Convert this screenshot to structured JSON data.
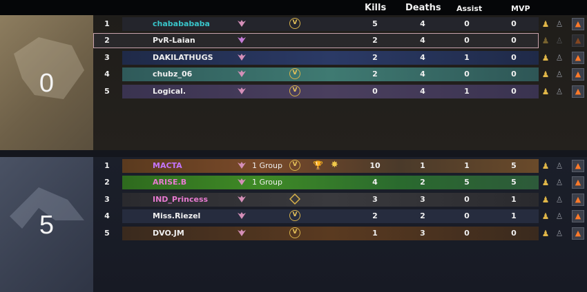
{
  "header": {
    "kills": "Kills",
    "deaths": "Deaths",
    "assist": "Assist",
    "mvp": "MVP"
  },
  "teams": [
    {
      "score": "0",
      "players": [
        {
          "num": "1",
          "name": "chababababa",
          "name_color": "teal",
          "group": "",
          "kills": "5",
          "deaths": "4",
          "assist": "0",
          "mvp": "0",
          "badge": "V"
        },
        {
          "num": "2",
          "name": "PvR-Laian",
          "name_color": "white",
          "group": "",
          "kills": "2",
          "deaths": "4",
          "assist": "0",
          "mvp": "0",
          "badge": ""
        },
        {
          "num": "3",
          "name": "DAKILATHUGS",
          "name_color": "white",
          "group": "",
          "kills": "2",
          "deaths": "4",
          "assist": "1",
          "mvp": "0",
          "badge": ""
        },
        {
          "num": "4",
          "name": "chubz_06",
          "name_color": "white",
          "group": "",
          "kills": "2",
          "deaths": "4",
          "assist": "0",
          "mvp": "0",
          "badge": "V"
        },
        {
          "num": "5",
          "name": "Logical.",
          "name_color": "white",
          "group": "",
          "kills": "0",
          "deaths": "4",
          "assist": "1",
          "mvp": "0",
          "badge": "V"
        }
      ]
    },
    {
      "score": "5",
      "players": [
        {
          "num": "1",
          "name": "MACTA",
          "name_color": "purple",
          "group": "1 Group",
          "kills": "10",
          "deaths": "1",
          "assist": "1",
          "mvp": "5",
          "badge": "V"
        },
        {
          "num": "2",
          "name": "ARISE.B",
          "name_color": "pink",
          "group": "1 Group",
          "kills": "4",
          "deaths": "2",
          "assist": "5",
          "mvp": "5",
          "badge": ""
        },
        {
          "num": "3",
          "name": "IND_Princess",
          "name_color": "pink",
          "group": "",
          "kills": "3",
          "deaths": "3",
          "assist": "0",
          "mvp": "1",
          "badge": ""
        },
        {
          "num": "4",
          "name": "Miss.Riezel",
          "name_color": "white",
          "group": "",
          "kills": "2",
          "deaths": "2",
          "assist": "0",
          "mvp": "1",
          "badge": "V"
        },
        {
          "num": "5",
          "name": "DVO.JM",
          "name_color": "white",
          "group": "",
          "kills": "1",
          "deaths": "3",
          "assist": "0",
          "mvp": "0",
          "badge": "V"
        }
      ]
    }
  ],
  "colors": {
    "teal": "#39c4c9",
    "pink": "#e77ad0",
    "purple": "#c575ff",
    "gold": "#d8b24a"
  }
}
